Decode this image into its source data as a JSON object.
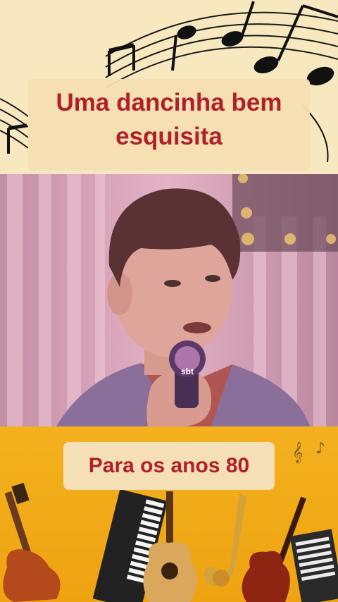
{
  "title": {
    "line1": "Uma dancinha bem",
    "line2": "esquisita"
  },
  "subtitle": "Para os anos 80",
  "video": {
    "mic_logo": "sbt"
  },
  "colors": {
    "title_red": "#b0202a",
    "card_cream": "#f6dfb2",
    "bottom_orange": "#f4b11d"
  },
  "icons": [
    "music-notes-icon",
    "treble-clef-icon",
    "guitar-icon",
    "keyboard-icon",
    "acoustic-guitar-icon",
    "saxophone-icon",
    "violin-icon",
    "accordion-icon"
  ]
}
